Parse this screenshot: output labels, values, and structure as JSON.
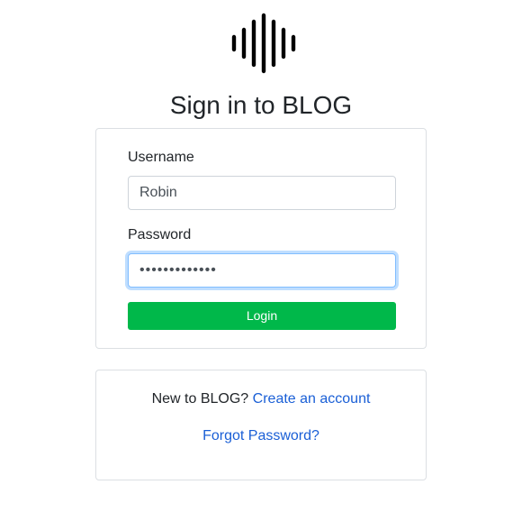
{
  "logo": {
    "icon": "soundwave-logo-icon",
    "color": "#000000"
  },
  "title": "Sign in to BLOG",
  "login_form": {
    "username_label": "Username",
    "username_value": "Robin",
    "password_label": "Password",
    "password_value": "•••••••••••••",
    "login_button": "Login",
    "button_color": "#00b84a"
  },
  "signup_panel": {
    "prompt": "New to BLOG?",
    "create_link": "Create an account",
    "forgot_link": "Forgot Password?",
    "link_color": "#1a5fd6"
  }
}
